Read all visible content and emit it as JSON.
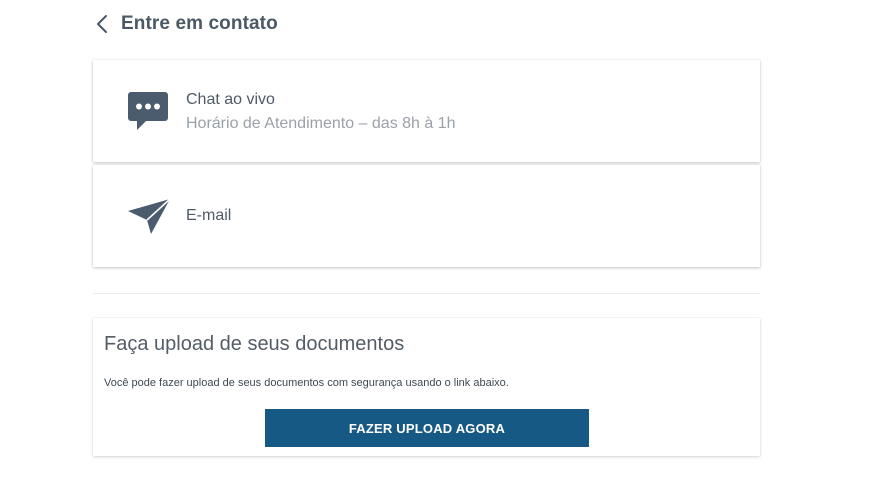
{
  "header": {
    "title": "Entre em contato",
    "back_icon": "chevron-left-icon"
  },
  "contacts": [
    {
      "icon": "chat-bubble-icon",
      "title": "Chat ao vivo",
      "subtitle": "Horário de Atendimento – das 8h à 1h"
    },
    {
      "icon": "paper-plane-icon",
      "title": "E-mail"
    }
  ],
  "upload": {
    "title": "Faça upload de seus documentos",
    "description": "Você pode fazer upload de seus documentos com segurança usando o link abaixo.",
    "button_label": "FAZER UPLOAD AGORA"
  },
  "colors": {
    "icon": "#4b5c6e",
    "button": "#175985",
    "title": "#4b5866",
    "muted": "#9aa1a8"
  }
}
